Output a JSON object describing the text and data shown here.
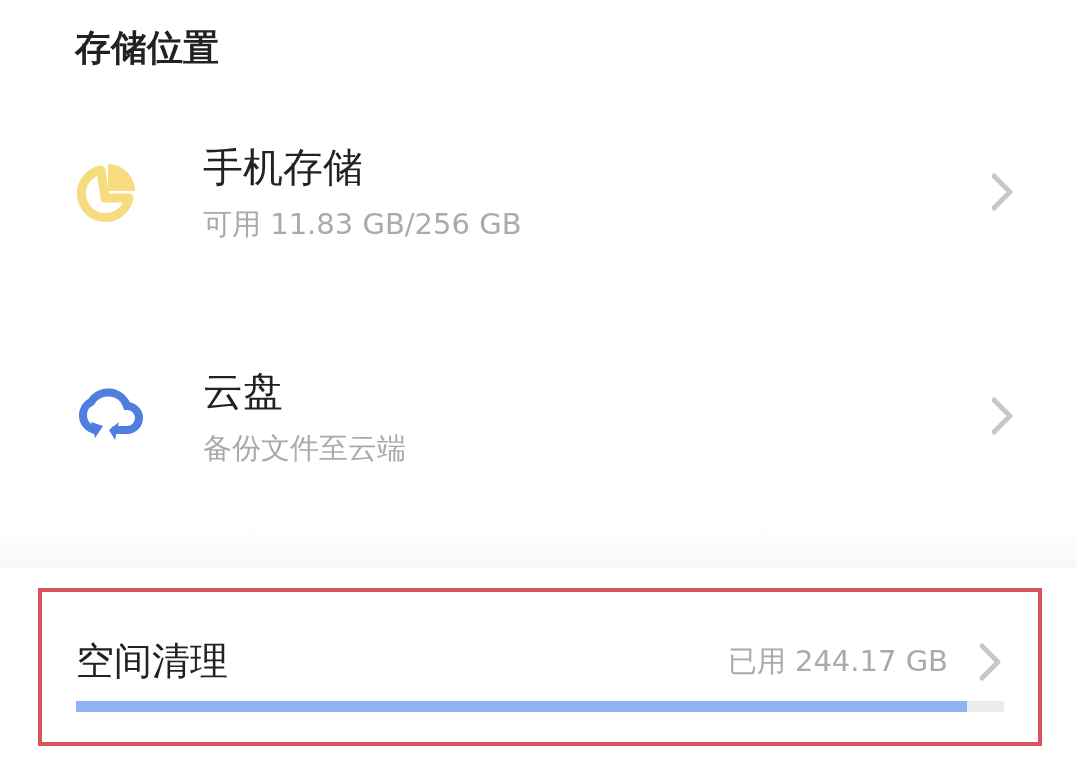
{
  "heading": "存储位置",
  "locations": [
    {
      "kind": "pie",
      "title": "手机存储",
      "subtitle": "可用 11.83 GB/256 GB"
    },
    {
      "kind": "cloud",
      "title": "云盘",
      "subtitle": "备份文件至云端"
    }
  ],
  "cleanup": {
    "title": "空间清理",
    "reading": "已用 244.17 GB",
    "level": 0.96,
    "highlighted": true
  }
}
